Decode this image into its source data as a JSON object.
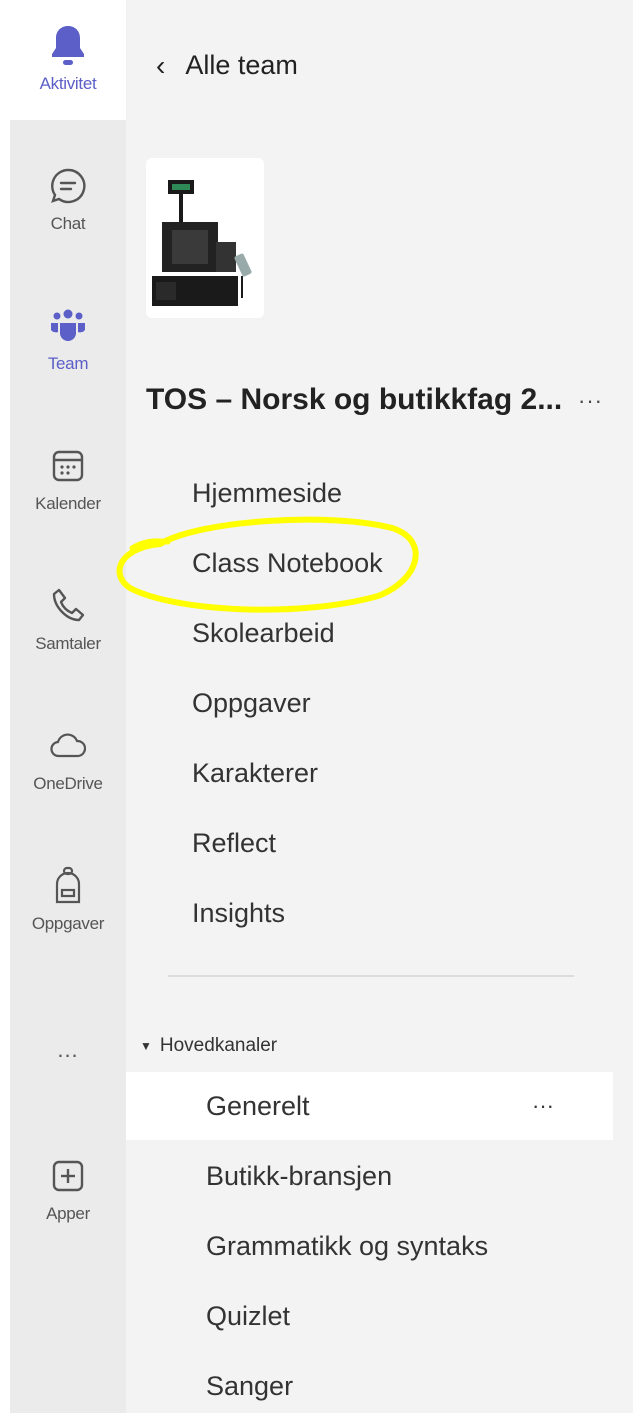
{
  "rail": {
    "items": [
      {
        "label": "Aktivitet",
        "icon": "bell-icon"
      },
      {
        "label": "Chat",
        "icon": "chat-icon"
      },
      {
        "label": "Team",
        "icon": "teams-icon"
      },
      {
        "label": "Kalender",
        "icon": "calendar-icon"
      },
      {
        "label": "Samtaler",
        "icon": "phone-icon"
      },
      {
        "label": "OneDrive",
        "icon": "cloud-icon"
      },
      {
        "label": "Oppgaver",
        "icon": "backpack-icon"
      },
      {
        "label": "...",
        "icon": "more-icon"
      },
      {
        "label": "Apper",
        "icon": "plus-icon"
      }
    ],
    "accent": "#5b5fc7"
  },
  "panel": {
    "back_label": "Alle team",
    "team_name": "TOS – Norsk og butikkfag 2...",
    "team_more": "···",
    "tabs": [
      "Hjemmeside",
      "Class Notebook",
      "Skolearbeid",
      "Oppgaver",
      "Karakterer",
      "Reflect",
      "Insights"
    ],
    "section_label": "Hovedkanaler",
    "channels": [
      {
        "name": "Generelt",
        "more": "···"
      },
      {
        "name": "Butikk-bransjen"
      },
      {
        "name": "Grammatikk og syntaks"
      },
      {
        "name": "Quizlet"
      },
      {
        "name": "Sanger"
      }
    ]
  },
  "highlight_color": "#ffff00"
}
